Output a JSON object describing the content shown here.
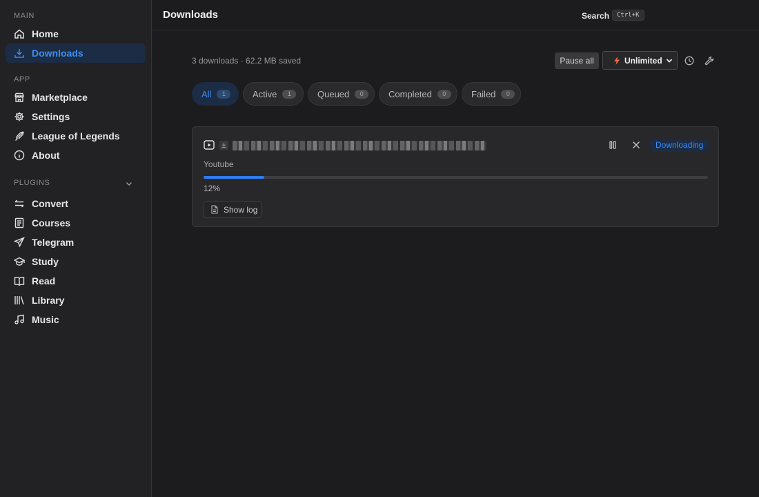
{
  "sidebar": {
    "sections": {
      "main": "MAIN",
      "app": "APP",
      "plugins": "PLUGINS"
    },
    "main_items": [
      {
        "label": "Home",
        "icon": "home-icon"
      },
      {
        "label": "Downloads",
        "icon": "download-icon",
        "active": true
      }
    ],
    "app_items": [
      {
        "label": "Marketplace",
        "icon": "store-icon"
      },
      {
        "label": "Settings",
        "icon": "gear-icon"
      },
      {
        "label": "League of Legends",
        "icon": "sword-icon"
      },
      {
        "label": "About",
        "icon": "info-icon"
      }
    ],
    "plugin_items": [
      {
        "label": "Convert",
        "icon": "swap-icon"
      },
      {
        "label": "Courses",
        "icon": "book-open-icon"
      },
      {
        "label": "Telegram",
        "icon": "send-icon"
      },
      {
        "label": "Study",
        "icon": "graduation-cap-icon"
      },
      {
        "label": "Read",
        "icon": "open-book-icon"
      },
      {
        "label": "Library",
        "icon": "library-icon"
      },
      {
        "label": "Music",
        "icon": "music-note-icon"
      }
    ]
  },
  "header": {
    "title": "Downloads",
    "search_label": "Search",
    "search_shortcut": "Ctrl+K"
  },
  "toolbar": {
    "summary": "3 downloads · 62.2 MB saved",
    "pause_all_label": "Pause all",
    "speed_limit": "Unlimited"
  },
  "filters": [
    {
      "label": "All",
      "count": "1",
      "active": true
    },
    {
      "label": "Active",
      "count": "1"
    },
    {
      "label": "Queued",
      "count": "0"
    },
    {
      "label": "Completed",
      "count": "0"
    },
    {
      "label": "Failed",
      "count": "0"
    }
  ],
  "download": {
    "title": "",
    "source": "Youtube",
    "progress_fraction": 0.12,
    "progress_text": "12%",
    "status": "Downloading",
    "show_log_label": "Show log"
  },
  "colors": {
    "accent": "#3d8df5",
    "active_bg": "#1b2c44",
    "bolt": "#f06a3d"
  }
}
